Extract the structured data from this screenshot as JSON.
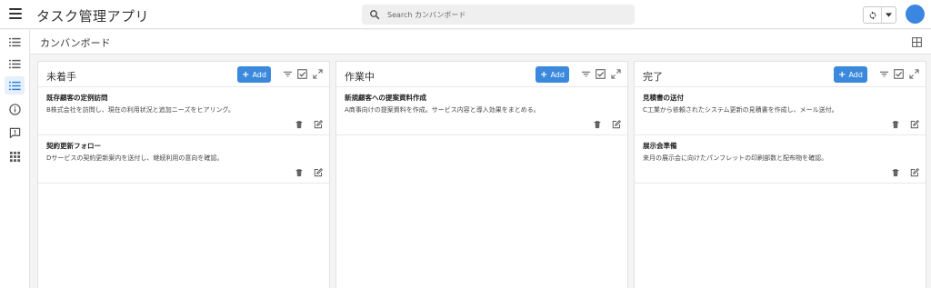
{
  "app": {
    "title": "タスク管理アプリ"
  },
  "search": {
    "placeholder": "Search カンバンボード"
  },
  "header": {
    "title": "カンバンボード"
  },
  "columns": [
    {
      "title": "未着手",
      "add_label": "Add",
      "cards": [
        {
          "title": "既存顧客の定例訪問",
          "desc": "B株式会社を訪問し、現在の利用状況と追加ニーズをヒアリング。"
        },
        {
          "title": "契約更新フォロー",
          "desc": "Dサービスの契約更新案内を送付し、継続利用の意向を確認。"
        }
      ]
    },
    {
      "title": "作業中",
      "add_label": "Add",
      "cards": [
        {
          "title": "新規顧客への提案資料作成",
          "desc": "A商事向けの提案資料を作成。サービス内容と導入効果をまとめる。"
        }
      ]
    },
    {
      "title": "完了",
      "add_label": "Add",
      "cards": [
        {
          "title": "見積書の送付",
          "desc": "C工業から依頼されたシステム更新の見積書を作成し、メール送付。"
        },
        {
          "title": "展示会準備",
          "desc": "来月の展示会に向けたパンフレットの印刷部数と配布物を確認。"
        }
      ]
    }
  ],
  "colors": {
    "accent": "#3b89dc",
    "avatar": "#3a86e0",
    "active_nav": "#2f7ed8"
  }
}
